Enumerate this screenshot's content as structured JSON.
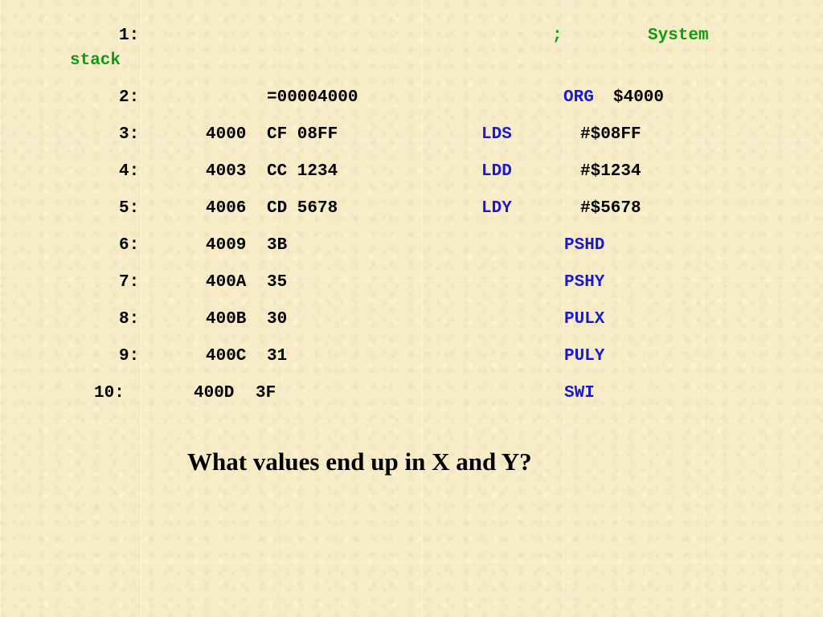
{
  "lines": [
    {
      "num": "1:",
      "comment_semi": ";",
      "comment_word": "System",
      "comment_wrap": "stack"
    },
    {
      "num": "2:",
      "hex": "=00004000",
      "mnem": "ORG",
      "operand": "$4000"
    },
    {
      "num": "3:",
      "addr": "4000",
      "hex": "CF 08FF",
      "mnem": "LDS",
      "operand": "#$08FF"
    },
    {
      "num": "4:",
      "addr": "4003",
      "hex": "CC 1234",
      "mnem": "LDD",
      "operand": "#$1234"
    },
    {
      "num": "5:",
      "addr": "4006",
      "hex": "CD 5678",
      "mnem": "LDY",
      "operand": "#$5678"
    },
    {
      "num": "6:",
      "addr": "4009",
      "hex": "3B",
      "mnem": "PSHD"
    },
    {
      "num": "7:",
      "addr": "400A",
      "hex": "35",
      "mnem": "PSHY"
    },
    {
      "num": "8:",
      "addr": "400B",
      "hex": "30",
      "mnem": "PULX"
    },
    {
      "num": "9:",
      "addr": "400C",
      "hex": "31",
      "mnem": "PULY"
    },
    {
      "num": "10:",
      "addr": "400D",
      "hex": "3F",
      "mnem": "SWI"
    }
  ],
  "question": "What values end up in X and Y?",
  "colors": {
    "comment": "#119a11",
    "mnemonic": "#1a1acc",
    "text": "#000000"
  }
}
